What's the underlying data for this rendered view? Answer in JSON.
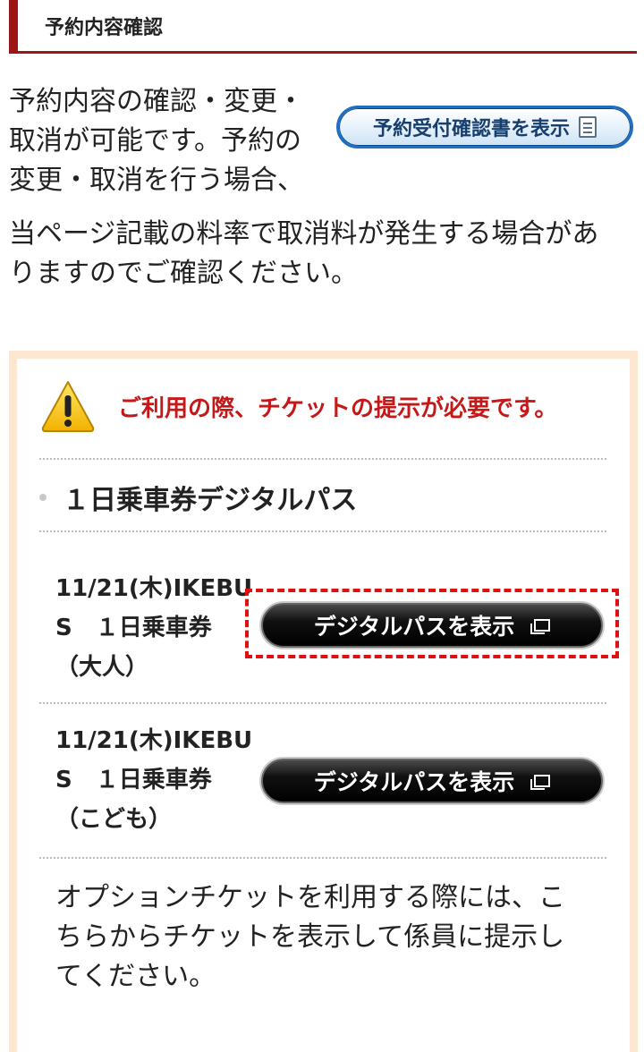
{
  "section": {
    "title": "予約内容確認"
  },
  "intro": {
    "line1": "予約内容の確認・変更・",
    "line2": "取消が可能です。予約の",
    "line3": "変更・取消を行う場合、",
    "line4": "当ページ記載の料率で取消料が発生する場合があ",
    "line5": "りますのでご確認ください。",
    "receipt_button": "予約受付確認書を表示",
    "receipt_icon": "pdf-document-icon"
  },
  "notice": {
    "warning_icon": "warning-triangle-icon",
    "warning_text": "ご利用の際、チケットの提示が必要です。",
    "pass_title": "１日乗車券デジタルパス",
    "tickets": [
      {
        "line1": "11/21(木)IKEBU",
        "line2": "S　１日乗車券",
        "line3": "（大人）",
        "button": "デジタルパスを表示"
      },
      {
        "line1": "11/21(木)IKEBU",
        "line2": "S　１日乗車券",
        "line3": "（こども）",
        "button": "デジタルパスを表示"
      }
    ],
    "note_line1": "オプションチケットを利用する際には、こ",
    "note_line2": "ちらからチケットを表示して係員に提示し",
    "note_line3": "てください。"
  },
  "colors": {
    "header_accent": "#9c1616",
    "warning_text": "#c51919",
    "notice_border": "#fde6d2",
    "highlight": "#e01010"
  }
}
